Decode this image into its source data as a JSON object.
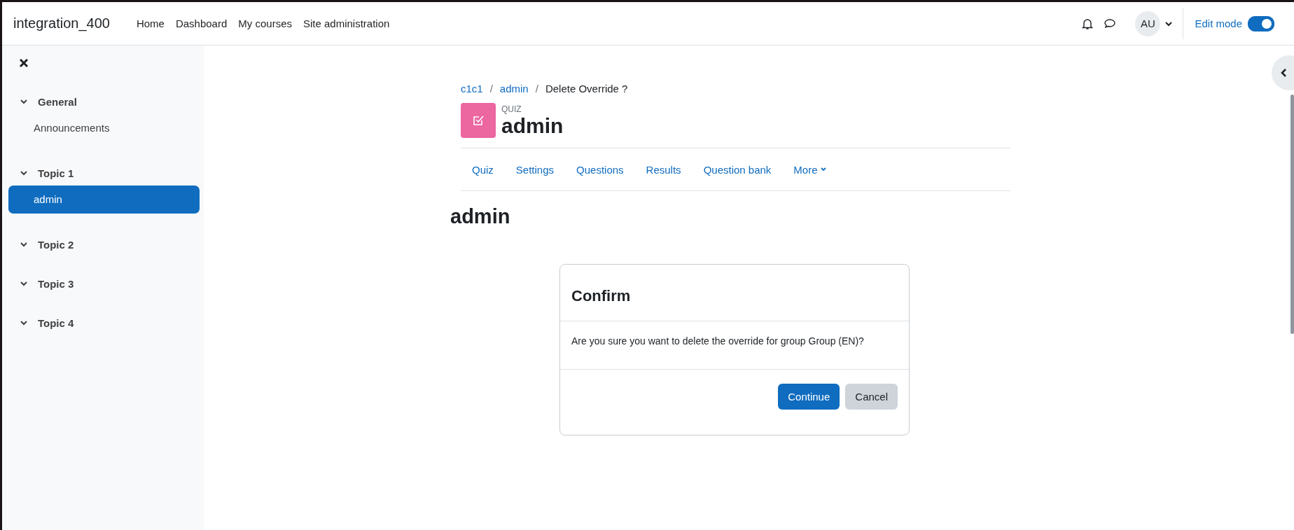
{
  "site_name": "integration_400",
  "nav": [
    {
      "label": "Home"
    },
    {
      "label": "Dashboard"
    },
    {
      "label": "My courses"
    },
    {
      "label": "Site administration"
    }
  ],
  "user": {
    "initials": "AU"
  },
  "edit_mode": {
    "label": "Edit mode",
    "on": true
  },
  "sidebar": {
    "sections": [
      {
        "title": "General",
        "expanded": true,
        "items": [
          {
            "label": "Announcements",
            "selected": false
          }
        ]
      },
      {
        "title": "Topic 1",
        "expanded": true,
        "items": [
          {
            "label": "admin",
            "selected": true
          }
        ]
      },
      {
        "title": "Topic 2",
        "expanded": true
      },
      {
        "title": "Topic 3",
        "expanded": true
      },
      {
        "title": "Topic 4",
        "expanded": true
      }
    ]
  },
  "breadcrumb": [
    {
      "label": "c1c1",
      "kind": "link"
    },
    {
      "separator": "/",
      "label": "admin",
      "kind": "link"
    },
    {
      "separator": "/",
      "label": "Delete Override ?",
      "kind": "current"
    }
  ],
  "activity": {
    "type": "QUIZ",
    "title": "admin"
  },
  "tabs": [
    {
      "label": "Quiz",
      "selected": false
    },
    {
      "label": "Settings",
      "selected": false
    },
    {
      "label": "Questions",
      "selected": false
    },
    {
      "label": "Results",
      "selected": false
    },
    {
      "label": "Question bank",
      "selected": false
    },
    {
      "label": "More",
      "selected": false,
      "dropdown": true
    }
  ],
  "page_heading": "admin",
  "dialog": {
    "title": "Confirm",
    "message": "Are you sure you want to delete the override for group Group (EN)?",
    "buttons": [
      {
        "label": "Continue",
        "kind": "primary"
      },
      {
        "label": "Cancel",
        "kind": "secondary"
      }
    ]
  }
}
